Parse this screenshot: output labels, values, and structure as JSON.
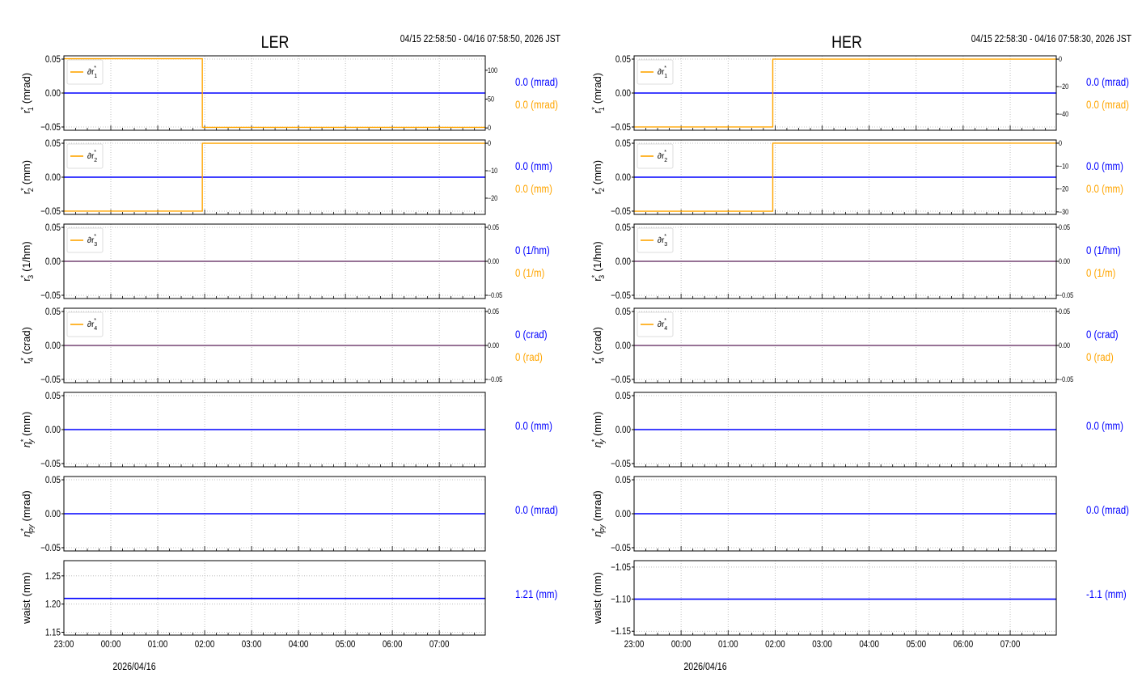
{
  "colors": {
    "main": "#0000ff",
    "delta": "#ffa500",
    "axis": "#000000",
    "grid": "#b0b0b0"
  },
  "chart_data": [
    {
      "type": "line",
      "title": "LER",
      "time_range": "04/15 22:58:50 - 04/16 07:58:50, 2026 JST",
      "date_label": "2026/04/16",
      "x_hours_range": [
        0,
        8.98
      ],
      "x_tick_labels": [
        "23:00",
        "00:00",
        "01:00",
        "02:00",
        "03:00",
        "04:00",
        "05:00",
        "06:00",
        "07:00"
      ],
      "panels": [
        {
          "ylabel": {
            "base": "r",
            "sup": "*",
            "sub": "1",
            "unit": "(mrad)"
          },
          "ylim": [
            -0.0548,
            0.0548
          ],
          "yticks": [
            "0.05",
            "0.00",
            "-0.05"
          ],
          "yvals": [
            0.05,
            0,
            -0.05
          ],
          "main_value": 0.0,
          "main_label": "0.0 (mrad)",
          "delta": {
            "legend": "∂r",
            "legend_sub": "1",
            "legend_sup": "*",
            "ylim": [
              -4,
              125
            ],
            "yticks": [
              "100",
              "50",
              "0"
            ],
            "yvals": [
              100,
              50,
              0
            ],
            "step_hour": 2.95,
            "before": 120,
            "after": 1,
            "label": "0.0 (mrad)"
          }
        },
        {
          "ylabel": {
            "base": "r",
            "sup": "*",
            "sub": "2",
            "unit": "(mm)"
          },
          "ylim": [
            -0.0548,
            0.0548
          ],
          "yticks": [
            "0.05",
            "0.00",
            "-0.05"
          ],
          "yvals": [
            0.05,
            0,
            -0.05
          ],
          "main_value": 0.0,
          "main_label": "0.0 (mm)",
          "delta": {
            "legend": "∂r",
            "legend_sub": "2",
            "legend_sup": "*",
            "ylim": [
              -25.9,
              1.2
            ],
            "yticks": [
              "0",
              "−10",
              "−20"
            ],
            "yvals": [
              0,
              -10,
              -20
            ],
            "step_hour": 2.95,
            "before": -24.7,
            "after": 0,
            "label": "0.0 (mm)"
          }
        },
        {
          "ylabel": {
            "base": "r",
            "sup": "*",
            "sub": "3",
            "unit": "(1/hm)"
          },
          "ylim": [
            -0.0548,
            0.0548
          ],
          "yticks": [
            "0.05",
            "0.00",
            "-0.05"
          ],
          "yvals": [
            0.05,
            0,
            -0.05
          ],
          "main_value": 0.0,
          "main_label": "0 (1/hm)",
          "delta": {
            "legend": "∂r",
            "legend_sub": "3",
            "legend_sup": "*",
            "ylim": [
              -0.0548,
              0.0548
            ],
            "yticks": [
              "0.05",
              "0.00",
              "−0.05"
            ],
            "yvals": [
              0.05,
              0,
              -0.05
            ],
            "step_hour": null,
            "before": 0,
            "after": 0,
            "label": "0 (1/m)"
          }
        },
        {
          "ylabel": {
            "base": "r",
            "sup": "*",
            "sub": "4",
            "unit": "(crad)"
          },
          "ylim": [
            -0.0548,
            0.0548
          ],
          "yticks": [
            "0.05",
            "0.00",
            "-0.05"
          ],
          "yvals": [
            0.05,
            0,
            -0.05
          ],
          "main_value": 0.0,
          "main_label": "0 (crad)",
          "delta": {
            "legend": "∂r",
            "legend_sub": "4",
            "legend_sup": "*",
            "ylim": [
              -0.0548,
              0.0548
            ],
            "yticks": [
              "0.05",
              "0.00",
              "−0.05"
            ],
            "yvals": [
              0.05,
              0,
              -0.05
            ],
            "step_hour": null,
            "before": 0,
            "after": 0,
            "label": "0 (rad)"
          }
        },
        {
          "ylabel": {
            "base": "η",
            "sup": "*",
            "sub": "y",
            "unit": "(mm)"
          },
          "ylim": [
            -0.0548,
            0.0548
          ],
          "yticks": [
            "0.05",
            "0.00",
            "-0.05"
          ],
          "yvals": [
            0.05,
            0,
            -0.05
          ],
          "main_value": 0.0,
          "main_label": "0.0 (mm)",
          "delta": null
        },
        {
          "ylabel": {
            "base": "η",
            "sup": "*",
            "sub": "py",
            "unit": "(mrad)"
          },
          "ylim": [
            -0.0548,
            0.0548
          ],
          "yticks": [
            "0.05",
            "0.00",
            "-0.05"
          ],
          "yvals": [
            0.05,
            0,
            -0.05
          ],
          "main_value": 0.0,
          "main_label": "0.0 (mrad)",
          "delta": null
        },
        {
          "ylabel": {
            "base": "waist",
            "sup": "",
            "sub": "",
            "unit": "(mm)"
          },
          "ylim": [
            1.145,
            1.277
          ],
          "yticks": [
            "1.25",
            "1.20",
            "1.15"
          ],
          "yvals": [
            1.25,
            1.2,
            1.15
          ],
          "main_value": 1.21,
          "main_label": "1.21 (mm)",
          "delta": null
        }
      ]
    },
    {
      "type": "line",
      "title": "HER",
      "time_range": "04/15 22:58:30 - 04/16 07:58:30, 2026 JST",
      "date_label": "2026/04/16",
      "x_hours_range": [
        0,
        8.98
      ],
      "x_tick_labels": [
        "23:00",
        "00:00",
        "01:00",
        "02:00",
        "03:00",
        "04:00",
        "05:00",
        "06:00",
        "07:00"
      ],
      "panels": [
        {
          "ylabel": {
            "base": "r",
            "sup": "*",
            "sub": "1",
            "unit": "(mrad)"
          },
          "ylim": [
            -0.0548,
            0.0548
          ],
          "yticks": [
            "0.05",
            "0.00",
            "-0.05"
          ],
          "yvals": [
            0.05,
            0,
            -0.05
          ],
          "main_value": 0.0,
          "main_label": "0.0 (mrad)",
          "delta": {
            "legend": "∂r",
            "legend_sub": "1",
            "legend_sup": "*",
            "ylim": [
              -51.8,
              2.4
            ],
            "yticks": [
              "0",
              "−20",
              "−40"
            ],
            "yvals": [
              0,
              -20,
              -40
            ],
            "step_hour": 2.95,
            "before": -49.4,
            "after": 0,
            "label": "0.0 (mrad)"
          }
        },
        {
          "ylabel": {
            "base": "r",
            "sup": "*",
            "sub": "2",
            "unit": "(mm)"
          },
          "ylim": [
            -0.0548,
            0.0548
          ],
          "yticks": [
            "0.05",
            "0.00",
            "-0.05"
          ],
          "yvals": [
            0.05,
            0,
            -0.05
          ],
          "main_value": 0.0,
          "main_label": "0.0 (mm)",
          "delta": {
            "legend": "∂r",
            "legend_sub": "2",
            "legend_sup": "*",
            "ylim": [
              -31.1,
              1.4
            ],
            "yticks": [
              "0",
              "−10",
              "−20",
              "−30"
            ],
            "yvals": [
              0,
              -10,
              -20,
              -30
            ],
            "step_hour": 2.95,
            "before": -29.7,
            "after": 0,
            "label": "0.0 (mm)"
          }
        },
        {
          "ylabel": {
            "base": "r",
            "sup": "*",
            "sub": "3",
            "unit": "(1/hm)"
          },
          "ylim": [
            -0.0548,
            0.0548
          ],
          "yticks": [
            "0.05",
            "0.00",
            "-0.05"
          ],
          "yvals": [
            0.05,
            0,
            -0.05
          ],
          "main_value": 0.0,
          "main_label": "0 (1/hm)",
          "delta": {
            "legend": "∂r",
            "legend_sub": "3",
            "legend_sup": "*",
            "ylim": [
              -0.0548,
              0.0548
            ],
            "yticks": [
              "0.05",
              "0.00",
              "−0.05"
            ],
            "yvals": [
              0.05,
              0,
              -0.05
            ],
            "step_hour": null,
            "before": 0,
            "after": 0,
            "label": "0 (1/m)"
          }
        },
        {
          "ylabel": {
            "base": "r",
            "sup": "*",
            "sub": "4",
            "unit": "(crad)"
          },
          "ylim": [
            -0.0548,
            0.0548
          ],
          "yticks": [
            "0.05",
            "0.00",
            "-0.05"
          ],
          "yvals": [
            0.05,
            0,
            -0.05
          ],
          "main_value": 0.0,
          "main_label": "0 (crad)",
          "delta": {
            "legend": "∂r",
            "legend_sub": "4",
            "legend_sup": "*",
            "ylim": [
              -0.0548,
              0.0548
            ],
            "yticks": [
              "0.05",
              "0.00",
              "−0.05"
            ],
            "yvals": [
              0.05,
              0,
              -0.05
            ],
            "step_hour": null,
            "before": 0,
            "after": 0,
            "label": "0 (rad)"
          }
        },
        {
          "ylabel": {
            "base": "η",
            "sup": "*",
            "sub": "y",
            "unit": "(mm)"
          },
          "ylim": [
            -0.0548,
            0.0548
          ],
          "yticks": [
            "0.05",
            "0.00",
            "-0.05"
          ],
          "yvals": [
            0.05,
            0,
            -0.05
          ],
          "main_value": 0.0,
          "main_label": "0.0 (mm)",
          "delta": null
        },
        {
          "ylabel": {
            "base": "η",
            "sup": "*",
            "sub": "py",
            "unit": "(mrad)"
          },
          "ylim": [
            -0.0548,
            0.0548
          ],
          "yticks": [
            "0.05",
            "0.00",
            "-0.05"
          ],
          "yvals": [
            0.05,
            0,
            -0.05
          ],
          "main_value": 0.0,
          "main_label": "0.0 (mrad)",
          "delta": null
        },
        {
          "ylabel": {
            "base": "waist",
            "sup": "",
            "sub": "",
            "unit": "(mm)"
          },
          "ylim": [
            -1.156,
            -1.04
          ],
          "yticks": [
            "-1.05",
            "-1.10",
            "-1.15"
          ],
          "yvals": [
            -1.05,
            -1.1,
            -1.15
          ],
          "main_value": -1.1,
          "main_label": "-1.1 (mm)",
          "delta": null
        }
      ]
    }
  ]
}
